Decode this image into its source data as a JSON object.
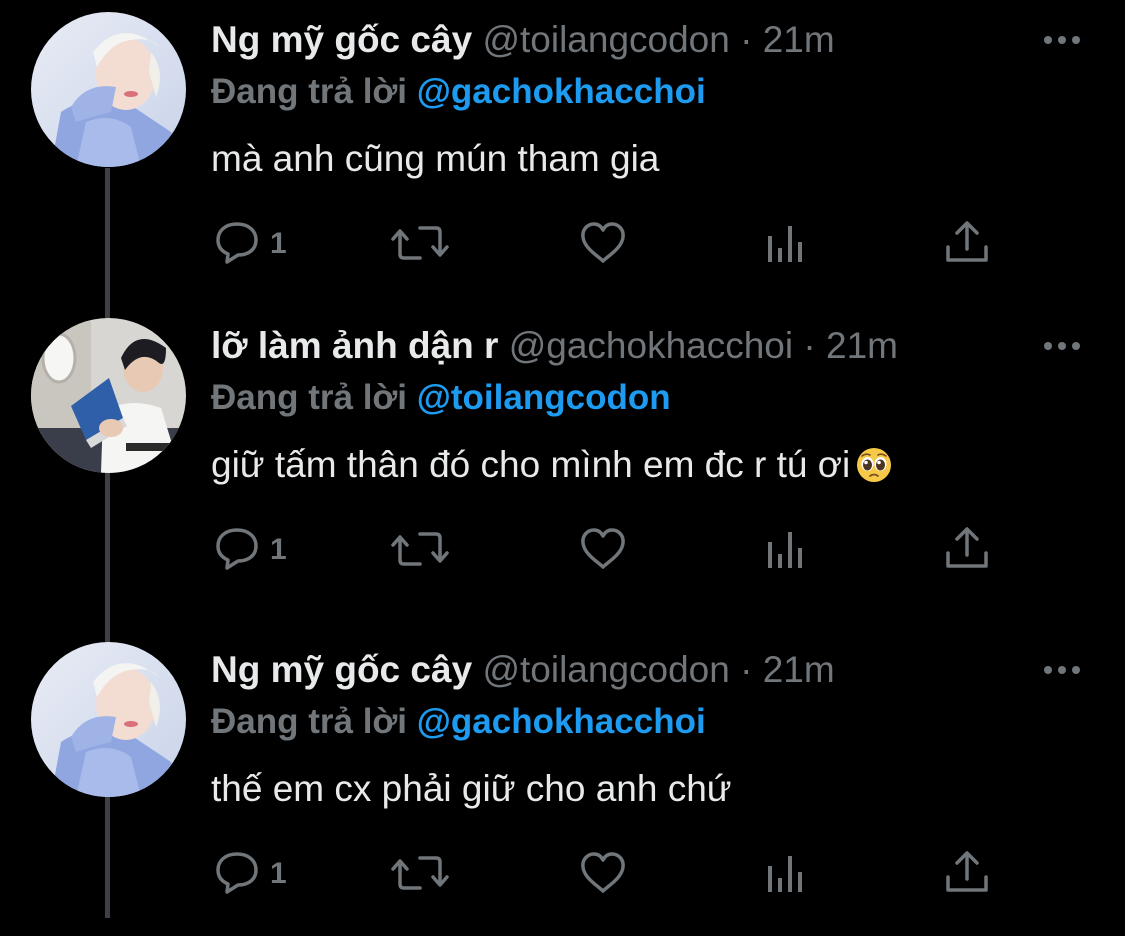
{
  "colors": {
    "background": "#000000",
    "primary_text": "#e7e9ea",
    "secondary_text": "#71767b",
    "accent": "#1d9bf0",
    "thread_line": "#3d4145"
  },
  "icons": {
    "more": "more-horizontal-icon",
    "reply": "reply-bubble-icon",
    "retweet": "retweet-icon",
    "like": "heart-icon",
    "views": "views-bar-chart-icon",
    "share": "share-upload-icon",
    "emoji": "pleading-face-emoji"
  },
  "tweets": [
    {
      "name": "Ng mỹ gốc cây",
      "handle": "@toilangcodon",
      "separator": "·",
      "time": "21m",
      "replying_label": "Đang trả lời",
      "replying_to": "@gachokhacchoi",
      "text": "mà anh cũng mún tham gia",
      "reply_count": "1"
    },
    {
      "name": "lỡ làm ảnh dận r",
      "handle": "@gachokhacchoi",
      "separator": "·",
      "time": "21m",
      "replying_label": "Đang trả lời",
      "replying_to": "@toilangcodon",
      "text": "giữ tấm thân đó cho mình em đc r tú ơi",
      "reply_count": "1"
    },
    {
      "name": "Ng mỹ gốc cây",
      "handle": "@toilangcodon",
      "separator": "·",
      "time": "21m",
      "replying_label": "Đang trả lời",
      "replying_to": "@gachokhacchoi",
      "text": "thế em cx phải giữ cho anh chứ",
      "reply_count": "1"
    }
  ]
}
